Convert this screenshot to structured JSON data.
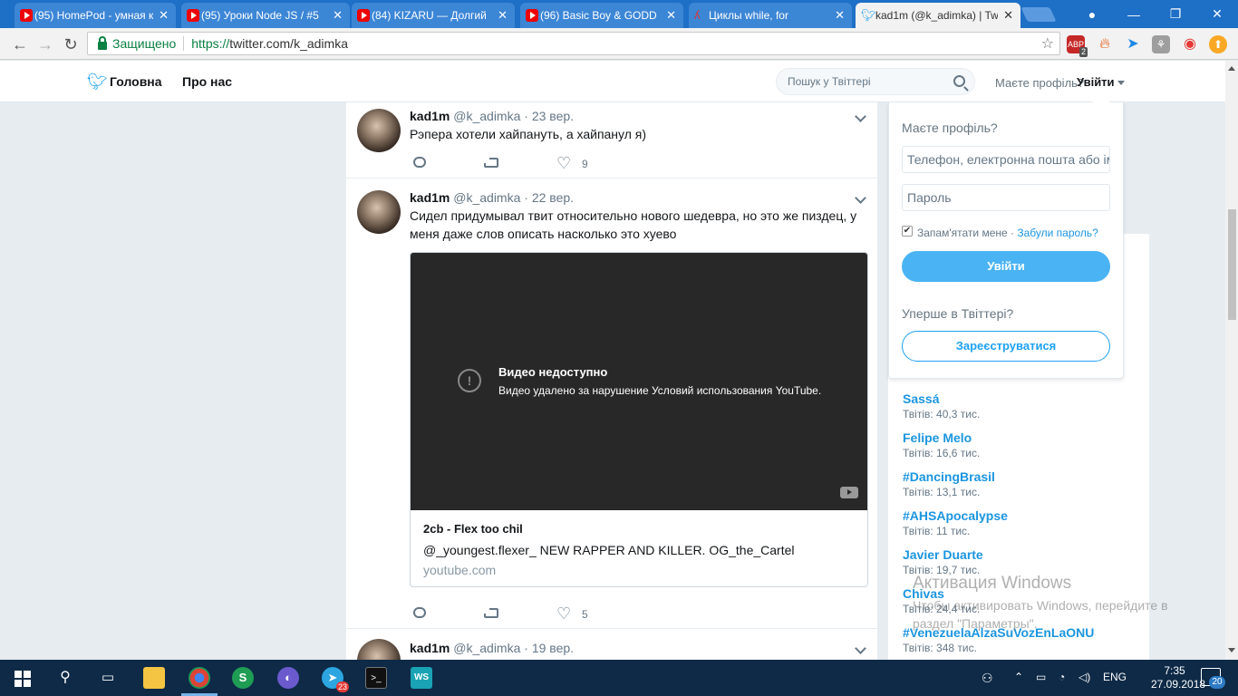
{
  "browser": {
    "tabs": [
      {
        "title": "(95) HomePod - умная к",
        "icon": "youtube-icon"
      },
      {
        "title": "(95) Уроки Node JS / #5",
        "icon": "youtube-icon"
      },
      {
        "title": "(84) KIZARU — Долгий",
        "icon": "youtube-icon"
      },
      {
        "title": "(96) Basic Boy & GODD",
        "icon": "youtube-icon"
      },
      {
        "title": "Циклы while, for",
        "icon": "html-icon"
      },
      {
        "title": "kad1m (@k_adimka) | Tw",
        "icon": "twitter-icon"
      }
    ],
    "secure_label": "Защищено",
    "url_scheme": "https://",
    "url_rest": "twitter.com/k_adimka",
    "ext_badge": "2"
  },
  "twitter": {
    "nav": {
      "home": "Головна",
      "about": "Про нас"
    },
    "search_placeholder": "Пошук у Твіттері",
    "header_prompt": "Маєте профіль?",
    "header_login": "Увійти"
  },
  "tweets": [
    {
      "name": "kad1m",
      "handle": "@k_adimka",
      "date": "· 23 вер.",
      "text": "Рэпера хотели хайпануть, а хайпанул я)",
      "likes": "9"
    },
    {
      "name": "kad1m",
      "handle": "@k_adimka",
      "date": "· 22 вер.",
      "text": "Сидел придумывал твит относительно нового шедевра, но это же пиздец, у меня даже слов описать насколько это хуево",
      "likes": "5",
      "video": {
        "title": "Видео недоступно",
        "message": "Видео удалено за нарушение Условий использования YouTube.",
        "card_title": "2cb - Flex too chil",
        "card_desc": "@_youngest.flexer_ NEW RAPPER AND KILLER. OG_the_Cartel",
        "card_domain": "youtube.com"
      }
    },
    {
      "name": "kad1m",
      "handle": "@k_adimka",
      "date": "· 19 вер."
    }
  ],
  "login_card": {
    "question": "Маєте профіль?",
    "username_placeholder": "Телефон, електронна пошта або ім",
    "password_placeholder": "Пароль",
    "remember": "Запам'ятати мене",
    "dot": " · ",
    "forgot": "Забули пароль?",
    "login_button": "Увійти",
    "new_question": "Уперше в Твіттері?",
    "signup_button": "Зареєструватися"
  },
  "trends": [
    {
      "name": "Sassá",
      "count": "Твітів: 40,3 тис."
    },
    {
      "name": "Felipe Melo",
      "count": "Твітів: 16,6 тис."
    },
    {
      "name": "#DancingBrasil",
      "count": "Твітів: 13,1 тис."
    },
    {
      "name": "#AHSApocalypse",
      "count": "Твітів: 11 тис."
    },
    {
      "name": "Javier Duarte",
      "count": "Твітів: 19,7 тис."
    },
    {
      "name": "Chivas",
      "count": "Твітів: 24,4 тис."
    },
    {
      "name": "#VenezuelaAlzaSuVozEnLaONU",
      "count": "Твітів: 348 тис."
    }
  ],
  "watermark": {
    "title": "Активация Windows",
    "subtitle": "Чтобы активировать Windows, перейдите в раздел \"Параметры\"."
  },
  "taskbar": {
    "telegram_badge": "23",
    "language": "ENG",
    "time": "7:35",
    "date": "27.09.2018",
    "notifications": "20"
  }
}
